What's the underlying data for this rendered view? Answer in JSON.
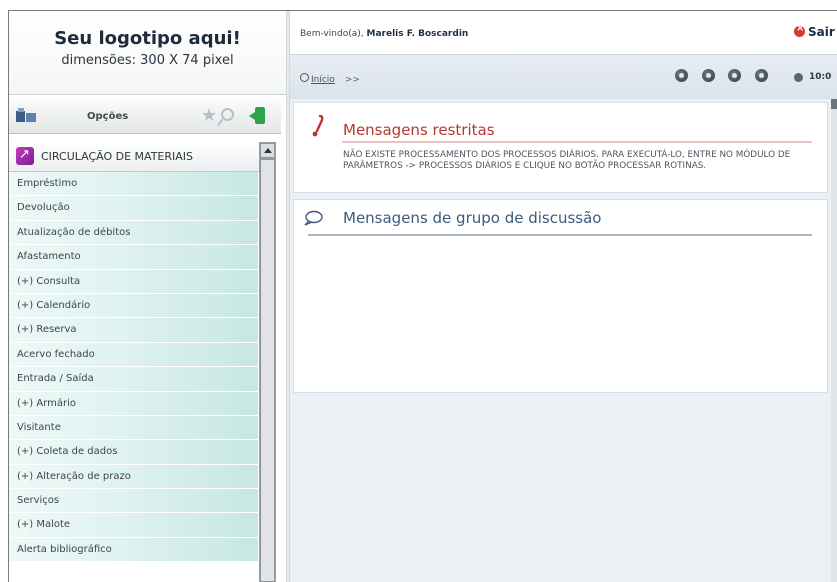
{
  "logo": {
    "title": "Seu logotipo aqui!",
    "subtitle": "dimensões: 300 X 74 pixel"
  },
  "header": {
    "welcome_prefix": "Bem-vindo(a),",
    "user_name": "Marelis F. Boscardin",
    "logout_label": "Sair",
    "breadcrumb_home": "Início",
    "breadcrumb_sep": ">>",
    "clock": "10:0"
  },
  "toolbar": {
    "icons": [
      "module-icon-1",
      "module-icon-2",
      "module-icon-3",
      "module-icon-4"
    ]
  },
  "sidebar": {
    "options_label": "Opções",
    "menu_title": "CIRCULAÇÃO DE MATERIAIS",
    "items": [
      "Empréstimo",
      "Devolução",
      "Atualização de débitos",
      "Afastamento",
      "(+) Consulta",
      "(+) Calendário",
      "(+) Reserva",
      "Acervo fechado",
      "Entrada / Saída",
      "(+) Armário",
      "Visitante",
      "(+) Coleta de dados",
      "(+) Alteração de prazo",
      "Serviços",
      "(+) Malote",
      "Alerta bibliográfico"
    ]
  },
  "panels": {
    "restricted": {
      "title": "Mensagens restritas",
      "text": "NÃO EXISTE PROCESSAMENTO DOS PROCESSOS DIÁRIOS. PARA EXECUTÁ-LO, ENTRE NO MÓDULO DE PARÂMETROS -> PROCESSOS DIÁRIOS E CLIQUE NO BOTÃO PROCESSAR ROTINAS."
    },
    "discussion": {
      "title": "Mensagens de grupo de discussão"
    }
  },
  "colors": {
    "menu_gradient": "#c6e7e3",
    "restricted_title": "#b23a2d",
    "discussion_title": "#3d5b7e"
  }
}
